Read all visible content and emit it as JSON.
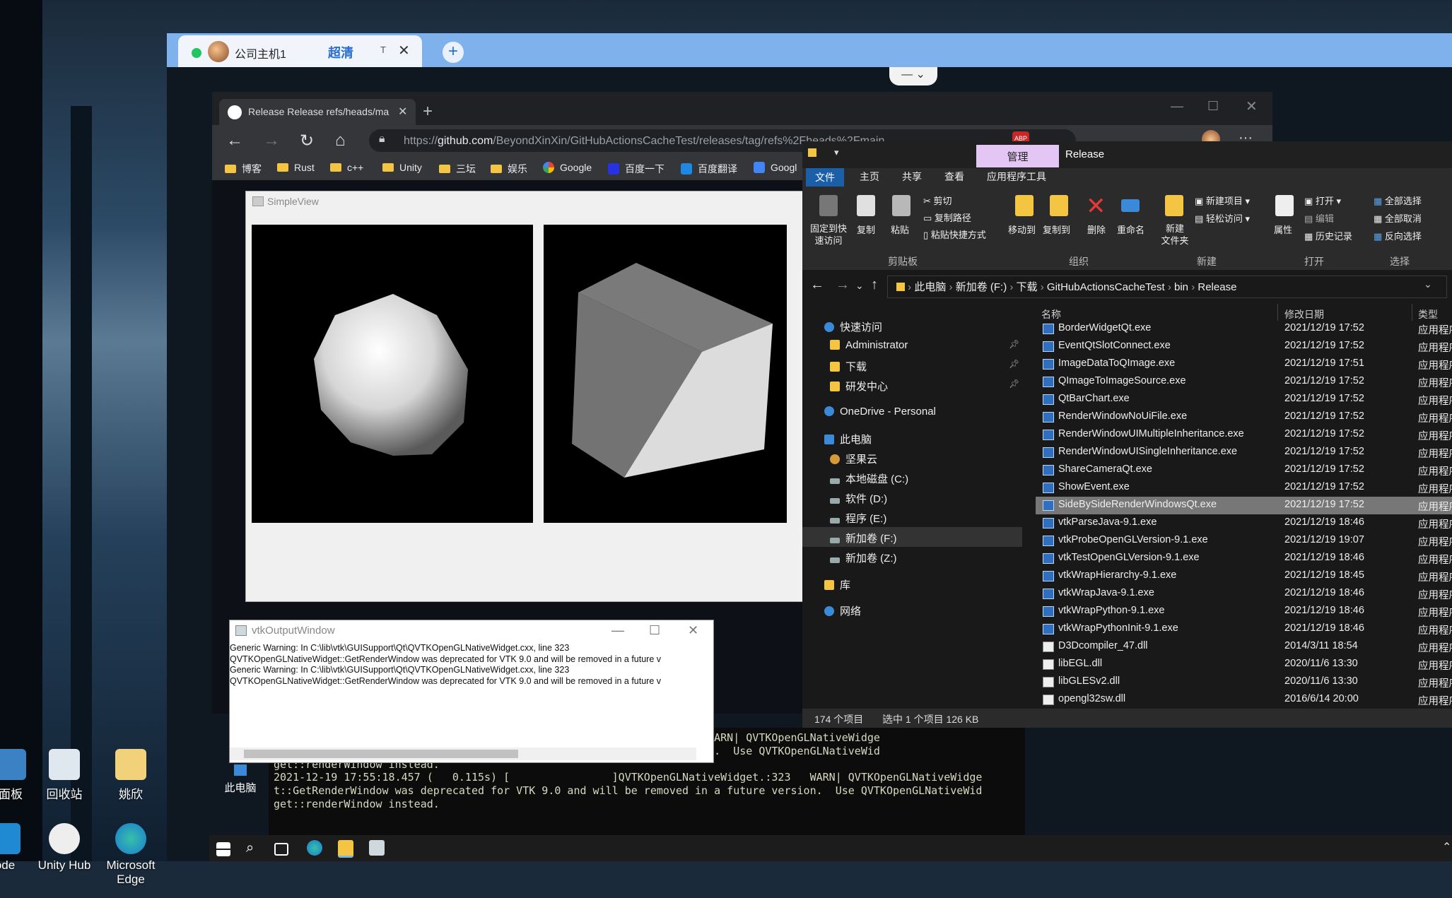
{
  "desktop": {
    "icons": [
      {
        "label": "面板"
      },
      {
        "label": "回收站"
      },
      {
        "label": "姚欣"
      },
      {
        "label": "ode"
      },
      {
        "label": "Unity Hub"
      },
      {
        "label": "Microsoft Edge"
      }
    ]
  },
  "remote_host": {
    "tab_title": "公司主机1",
    "quality": "超清",
    "t_label": "T",
    "close": "✕",
    "add": "+"
  },
  "browser": {
    "tab_title": "Release Release refs/heads/main",
    "url_prefix": "https://",
    "url_host": "github.com",
    "url_path": "/BeyondXinXin/GitHubActionsCacheTest/releases/tag/refs%2Fheads%2Fmain",
    "bookmarks": [
      "博客",
      "Rust",
      "c++",
      "Unity",
      "三坛",
      "娱乐",
      "Google",
      "百度一下",
      "百度翻译",
      "Googl"
    ],
    "adblock_badge": "ABP"
  },
  "simpleview": {
    "title": "SimpleView"
  },
  "vtk_output": {
    "title": "vtkOutputWindow",
    "lines": [
      "Generic Warning: In C:\\lib\\vtk\\GUISupport\\Qt\\QVTKOpenGLNativeWidget.cxx, line 323",
      "QVTKOpenGLNativeWidget::GetRenderWindow was deprecated for VTK 9.0 and will be removed in a future v",
      "",
      "Generic Warning: In C:\\lib\\vtk\\GUISupport\\Qt\\QVTKOpenGLNativeWidget.cxx, line 323",
      "QVTKOpenGLNativeWidget::GetRenderWindow was deprecated for VTK 9.0 and will be removed in a future v"
    ]
  },
  "console": {
    "lines": [
      "                                                  tiveWidget.:323   WARN| QVTKOpenGLNativeWidge",
      "                                                  in a future version.  Use QVTKOpenGLNativeWid",
      "get::renderWindow instead.",
      "2021-12-19 17:55:18.457 (   0.115s) [                ]QVTKOpenGLNativeWidget.:323   WARN| QVTKOpenGLNativeWidge",
      "t::GetRenderWindow was deprecated for VTK 9.0 and will be removed in a future version.  Use QVTKOpenGLNativeWid",
      "get::renderWindow instead."
    ]
  },
  "explorer": {
    "context_tab": "管理",
    "title": "Release",
    "tabs": [
      "文件",
      "主页",
      "共享",
      "查看",
      "应用程序工具"
    ],
    "ribbon": {
      "pin": "固定到快\n速访问",
      "copy": "复制",
      "paste": "粘贴",
      "cut": "剪切",
      "copy_path": "复制路径",
      "paste_shortcut": "粘贴快捷方式",
      "move_to": "移动到",
      "copy_to": "复制到",
      "delete": "删除",
      "rename": "重命名",
      "new_folder": "新建\n文件夹",
      "new_item": "新建项目",
      "easy_access": "轻松访问",
      "properties": "属性",
      "open": "打开",
      "edit": "编辑",
      "history": "历史记录",
      "select_all": "全部选择",
      "select_none": "全部取消",
      "invert": "反向选择",
      "groups": [
        "剪贴板",
        "组织",
        "新建",
        "打开",
        "选择"
      ]
    },
    "path": [
      "此电脑",
      "新加卷 (F:)",
      "下载",
      "GitHubActionsCacheTest",
      "bin",
      "Release"
    ],
    "nav": [
      {
        "label": "快速访问"
      },
      {
        "label": "Administrator"
      },
      {
        "label": "下载"
      },
      {
        "label": "研发中心"
      },
      {
        "label": "OneDrive - Personal"
      },
      {
        "label": "此电脑"
      },
      {
        "label": "坚果云"
      },
      {
        "label": "本地磁盘 (C:)"
      },
      {
        "label": "软件 (D:)"
      },
      {
        "label": "程序 (E:)"
      },
      {
        "label": "新加卷 (F:)"
      },
      {
        "label": "新加卷 (Z:)"
      },
      {
        "label": "库"
      },
      {
        "label": "网络"
      }
    ],
    "columns": {
      "name": "名称",
      "date": "修改日期",
      "type": "类型"
    },
    "files": [
      {
        "name": "BorderWidgetQt.exe",
        "date": "2021/12/19 17:52",
        "type": "应用程序"
      },
      {
        "name": "EventQtSlotConnect.exe",
        "date": "2021/12/19 17:52",
        "type": "应用程序"
      },
      {
        "name": "ImageDataToQImage.exe",
        "date": "2021/12/19 17:51",
        "type": "应用程序"
      },
      {
        "name": "QImageToImageSource.exe",
        "date": "2021/12/19 17:52",
        "type": "应用程序"
      },
      {
        "name": "QtBarChart.exe",
        "date": "2021/12/19 17:52",
        "type": "应用程序"
      },
      {
        "name": "RenderWindowNoUiFile.exe",
        "date": "2021/12/19 17:52",
        "type": "应用程序"
      },
      {
        "name": "RenderWindowUIMultipleInheritance.exe",
        "date": "2021/12/19 17:52",
        "type": "应用程序"
      },
      {
        "name": "RenderWindowUISingleInheritance.exe",
        "date": "2021/12/19 17:52",
        "type": "应用程序"
      },
      {
        "name": "ShareCameraQt.exe",
        "date": "2021/12/19 17:52",
        "type": "应用程序"
      },
      {
        "name": "ShowEvent.exe",
        "date": "2021/12/19 17:52",
        "type": "应用程序"
      },
      {
        "name": "SideBySideRenderWindowsQt.exe",
        "date": "2021/12/19 17:52",
        "type": "应用程序"
      },
      {
        "name": "vtkParseJava-9.1.exe",
        "date": "2021/12/19 18:46",
        "type": "应用程序"
      },
      {
        "name": "vtkProbeOpenGLVersion-9.1.exe",
        "date": "2021/12/19 19:07",
        "type": "应用程序"
      },
      {
        "name": "vtkTestOpenGLVersion-9.1.exe",
        "date": "2021/12/19 18:46",
        "type": "应用程序"
      },
      {
        "name": "vtkWrapHierarchy-9.1.exe",
        "date": "2021/12/19 18:45",
        "type": "应用程序"
      },
      {
        "name": "vtkWrapJava-9.1.exe",
        "date": "2021/12/19 18:46",
        "type": "应用程序"
      },
      {
        "name": "vtkWrapPython-9.1.exe",
        "date": "2021/12/19 18:46",
        "type": "应用程序"
      },
      {
        "name": "vtkWrapPythonInit-9.1.exe",
        "date": "2021/12/19 18:46",
        "type": "应用程序"
      },
      {
        "name": "D3Dcompiler_47.dll",
        "date": "2014/3/11 18:54",
        "type": "应用程序"
      },
      {
        "name": "libEGL.dll",
        "date": "2020/11/6 13:30",
        "type": "应用程序"
      },
      {
        "name": "libGLESv2.dll",
        "date": "2020/11/6 13:30",
        "type": "应用程序"
      },
      {
        "name": "opengl32sw.dll",
        "date": "2016/6/14 20:00",
        "type": "应用程序"
      }
    ],
    "selected_index": 10,
    "status": {
      "count": "174 个项目",
      "selected": "选中 1 个项目  126 KB"
    }
  },
  "taskbar": {
    "this_pc": "此电脑"
  },
  "colors": {
    "accent": "#1b5fa8",
    "host_tab_bar": "#7fb2ec",
    "manage_tab": "#e3c6f4"
  }
}
